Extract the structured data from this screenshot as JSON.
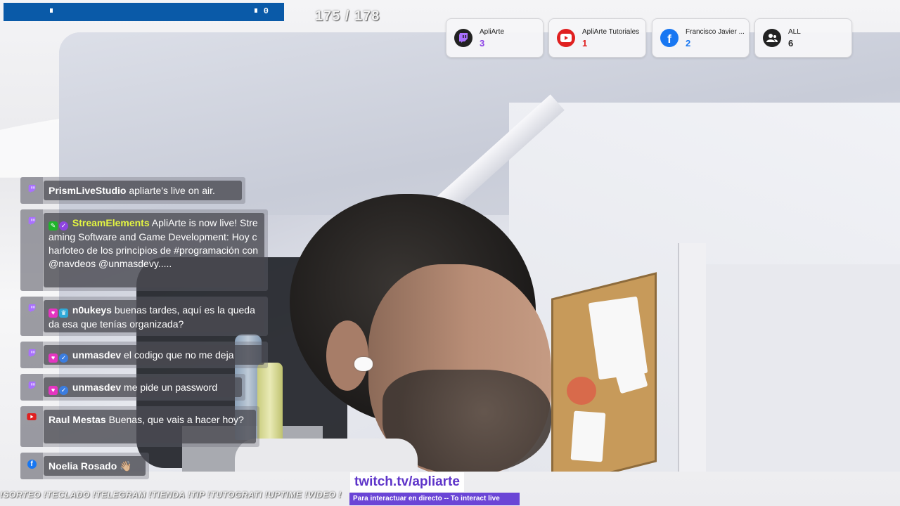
{
  "progress": {
    "count": "0",
    "colors": {
      "bar": "#0a5aa8"
    }
  },
  "pager": {
    "text": "175 / 178"
  },
  "platforms": [
    {
      "name": "ApliArte",
      "count": "3",
      "icon": "twitch-icon",
      "color": "#8b41e6"
    },
    {
      "name": "ApliArte Tutoriales",
      "count": "1",
      "icon": "youtube-icon",
      "color": "#e02020"
    },
    {
      "name": "Francisco Javier ...",
      "count": "2",
      "icon": "facebook-icon",
      "color": "#1877f2"
    },
    {
      "name": "ALL",
      "count": "6",
      "icon": "users-icon",
      "color": "#222222"
    }
  ],
  "chat": [
    {
      "platform": "twitch-icon",
      "user": "PrismLiveStudio",
      "text": "apliarte's live on air.",
      "user_color": "#ffffff"
    },
    {
      "platform": "twitch-icon",
      "user": "StreamElements",
      "text": "ApliArte is now live! Streaming Software and Game Development: Hoy charloteo de los principios de #programación con @navdeos @unmasdevy.....",
      "user_color": "#e4f542"
    },
    {
      "platform": "twitch-icon",
      "user": "n0ukeys",
      "text": "buenas tardes, aquí es la quedada esa que tenías organizada?",
      "user_color": "#ffffff"
    },
    {
      "platform": "twitch-icon",
      "user": "unmasdev",
      "text": "el codigo que no me deja",
      "user_color": "#ffffff"
    },
    {
      "platform": "twitch-icon",
      "user": "unmasdev",
      "text": "me pide un password",
      "user_color": "#ffffff"
    },
    {
      "platform": "youtube-icon",
      "user": "Raul Mestas",
      "text": "Buenas, que vais a hacer hoy?",
      "user_color": "#ffffff"
    },
    {
      "platform": "facebook-icon",
      "user": "Noelia Rosado",
      "text": "👋🏼",
      "user_color": "#ffffff"
    }
  ],
  "ticker": {
    "text": "!SORTEO !TECLADO !TELEGRAM !TIENDA !TIP !TUTOGRATI !UPTIME !VIDEO !"
  },
  "twitch_url": "twitch.tv/apliarte",
  "twitch_sub": "Para interactuar en directo -- To interact live"
}
